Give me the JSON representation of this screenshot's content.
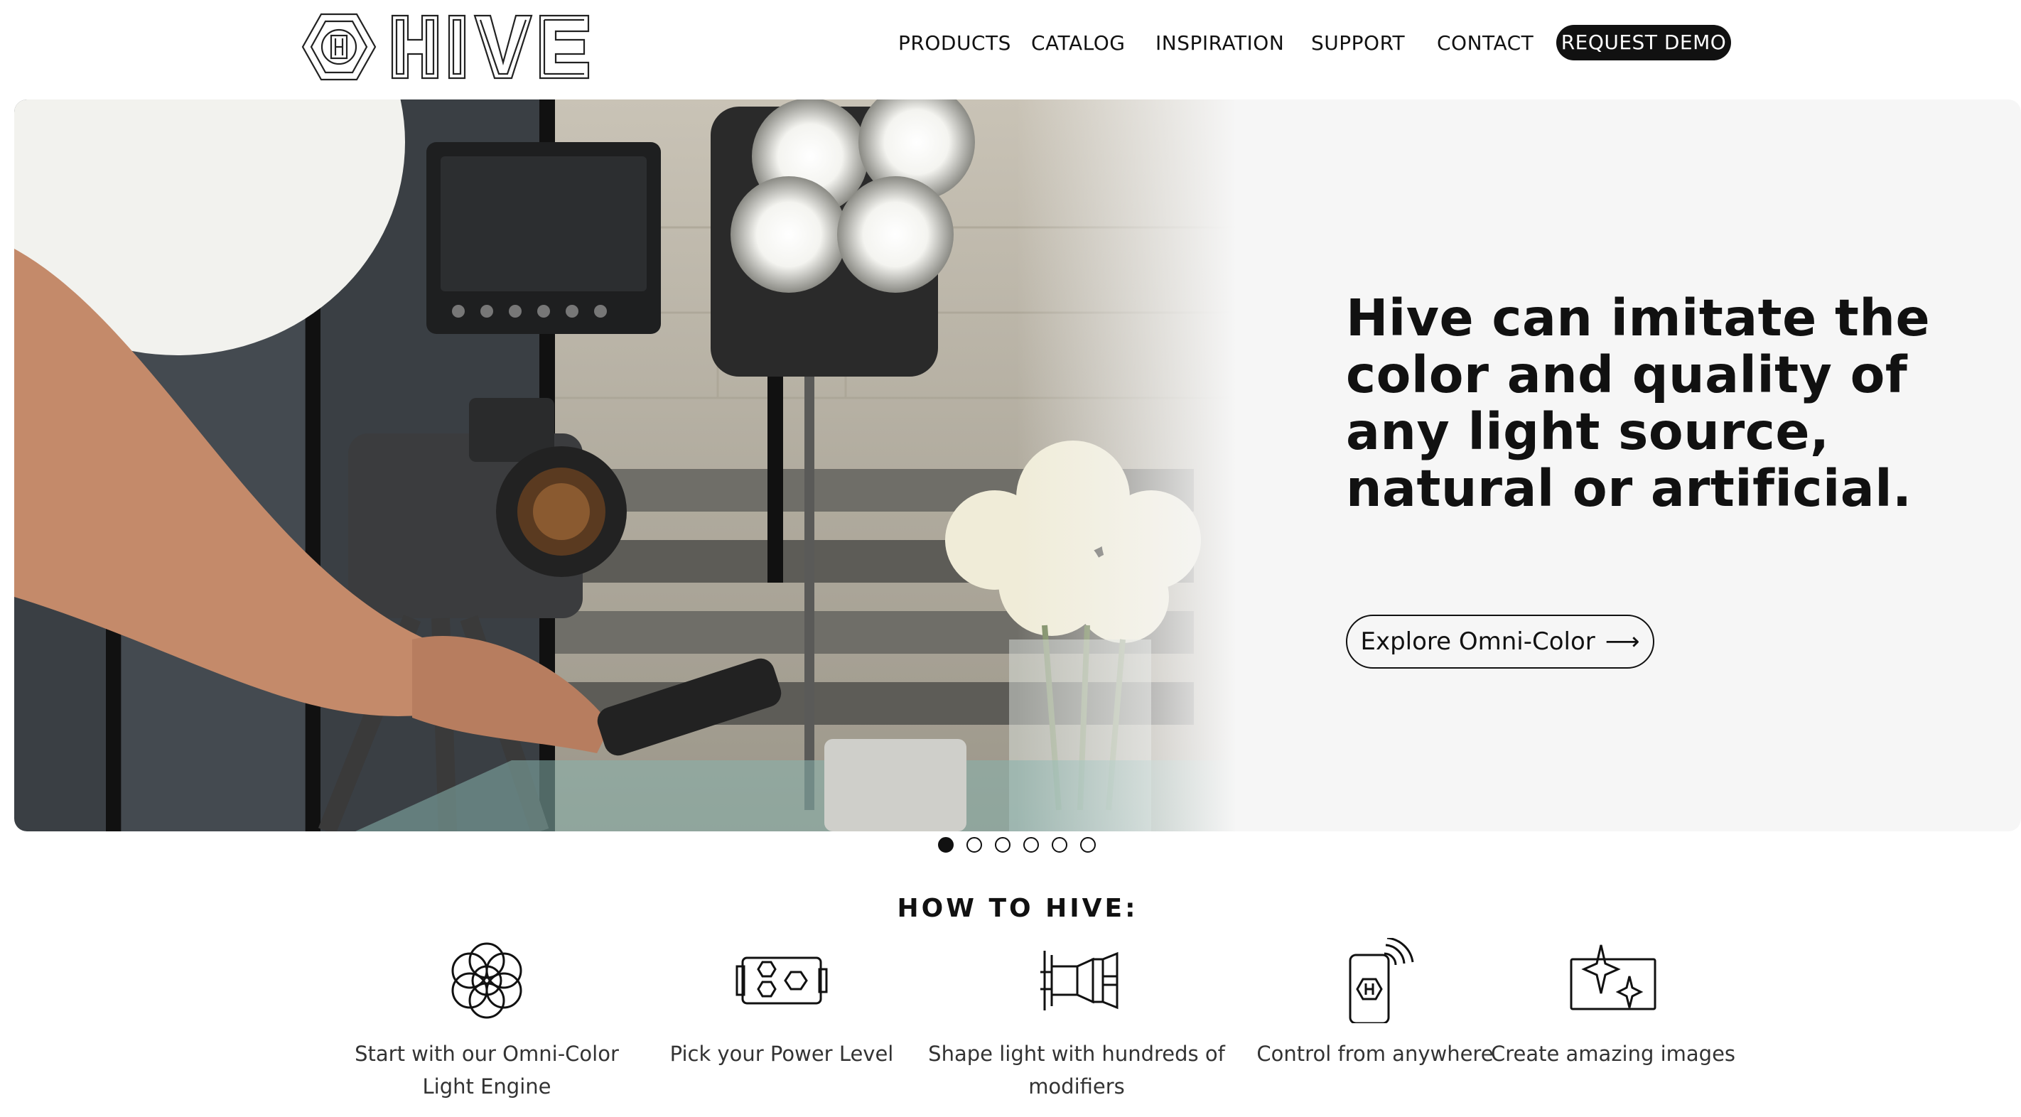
{
  "header": {
    "logo_text": "HIVE",
    "nav": [
      {
        "label": "PRODUCTS"
      },
      {
        "label": "CATALOG"
      },
      {
        "label": "INSPIRATION"
      },
      {
        "label": "SUPPORT"
      },
      {
        "label": "CONTACT"
      }
    ],
    "demo_label": "REQUEST DEMO"
  },
  "hero": {
    "headline": "Hive can imitate the color and quality of any light source, natural or artificial.",
    "cta_label": "Explore Omni-Color",
    "cta_arrow": "⟶",
    "photo_icon": "camera-light-scene-image"
  },
  "carousel": {
    "count": 6,
    "active_index": 0
  },
  "how_to": {
    "title": "HOW TO HIVE:",
    "steps": [
      {
        "label": "Start with our Omni-Color Light Engine",
        "icon": "flower-engine-icon"
      },
      {
        "label": "Pick your Power Level",
        "icon": "power-level-icon"
      },
      {
        "label": "Shape light with hundreds of modifiers",
        "icon": "modifier-icon"
      },
      {
        "label": "Control from anywhere",
        "icon": "phone-wireless-icon"
      },
      {
        "label": "Create amazing images",
        "icon": "sparkle-image-icon"
      }
    ]
  },
  "colors": {
    "accent": "#111111",
    "background": "#ffffff",
    "hero_panel": "#f6f6f6"
  }
}
